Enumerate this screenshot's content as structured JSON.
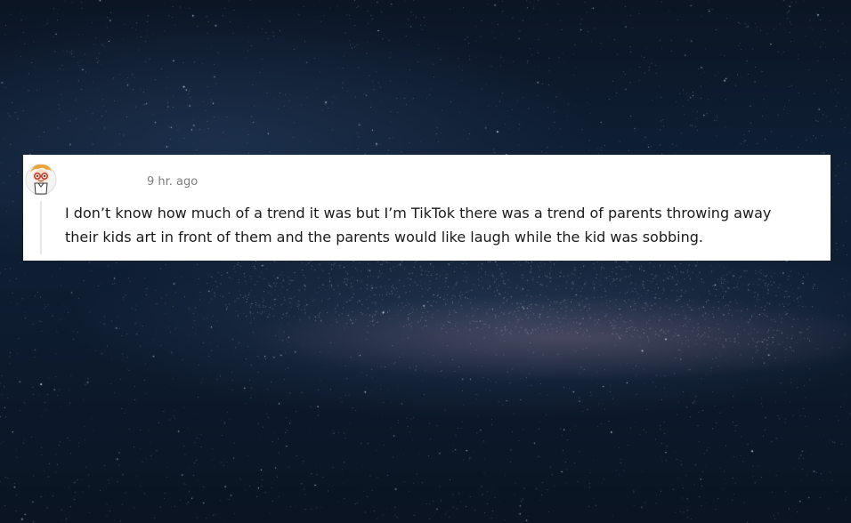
{
  "background": {
    "description_icon": "starry-night-sky",
    "colors": {
      "deep_sky": "#0b1524",
      "mid_sky": "#0f2036",
      "star": "#ffffff",
      "nebula": "#9a7890"
    }
  },
  "comment": {
    "avatar_icon": "snoo-avatar-icon",
    "timestamp": "9 hr. ago",
    "body": "I don’t know how much of a trend it was but I’m TikTok there was a trend of parents throwing away their kids art in front of them and the parents would like laugh while the kid was sobbing."
  }
}
